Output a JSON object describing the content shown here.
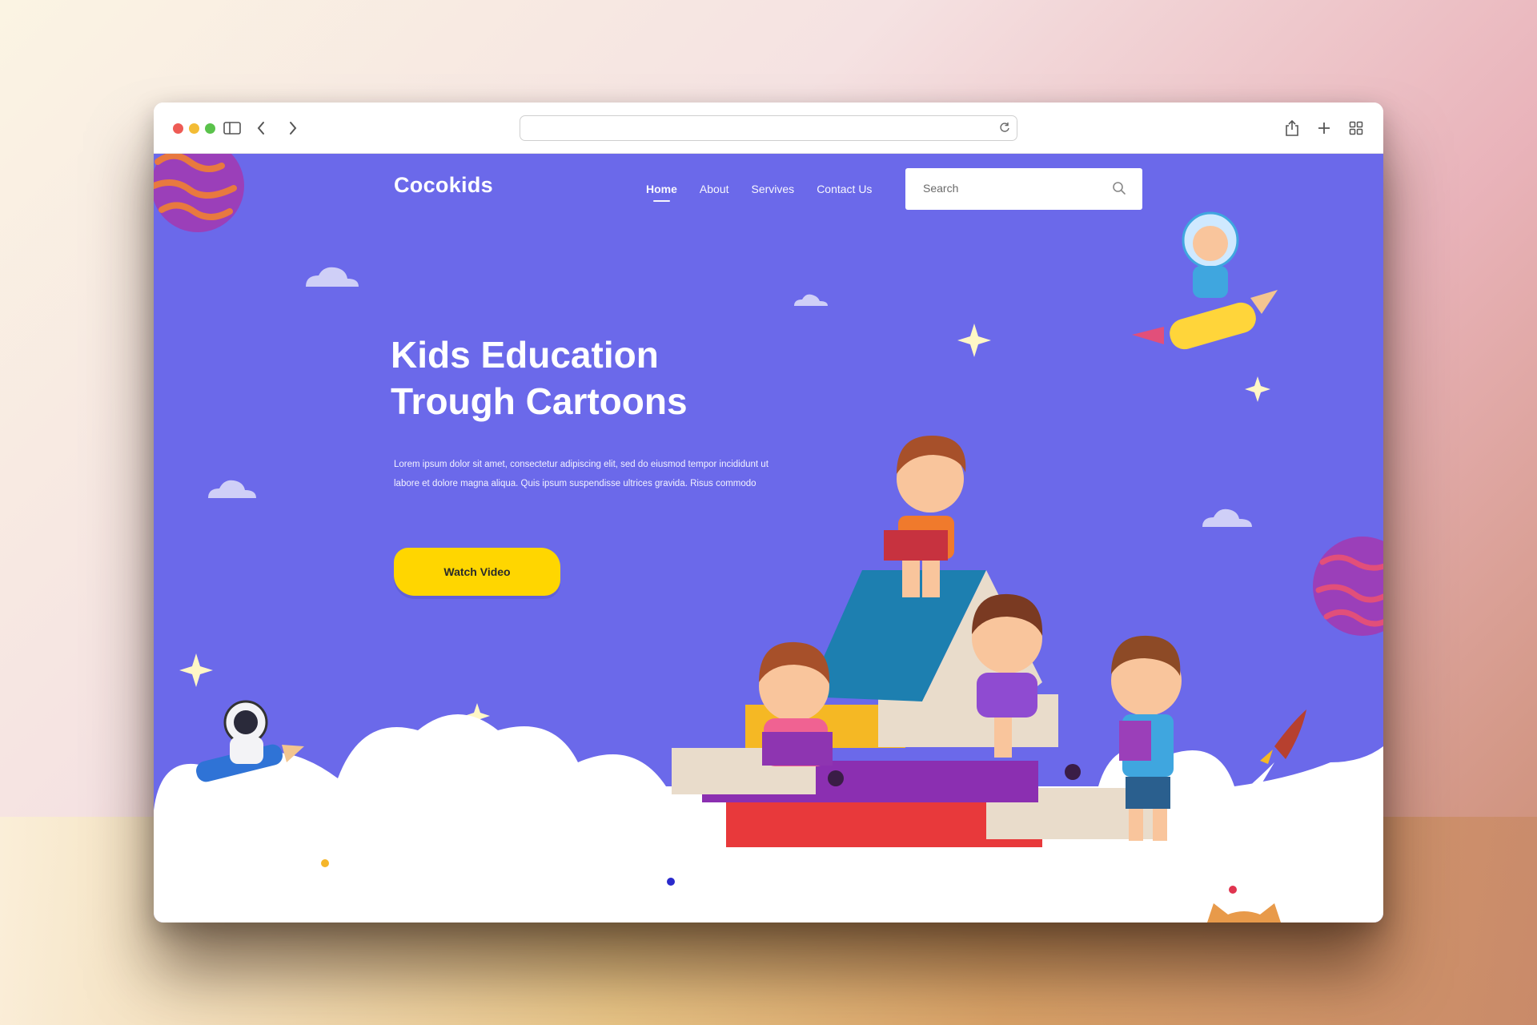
{
  "browser": {
    "address_value": "",
    "icons": [
      "sidebar-icon",
      "back-icon",
      "forward-icon",
      "reload-icon",
      "share-icon",
      "new-tab-icon",
      "tab-overview-icon"
    ]
  },
  "site": {
    "logo": "Cocokids",
    "nav": [
      {
        "label": "Home",
        "active": true
      },
      {
        "label": "About",
        "active": false
      },
      {
        "label": "Servives",
        "active": false
      },
      {
        "label": "Contact Us",
        "active": false
      }
    ],
    "search": {
      "placeholder": "Search",
      "value": ""
    }
  },
  "hero": {
    "title_line1": "Kids Education",
    "title_line2": "Trough Cartoons",
    "text": "Lorem ipsum dolor sit amet, consectetur adipiscing elit, sed do eiusmod tempor incididunt ut labore et dolore magna aliqua. Quis ipsum suspendisse ultrices gravida. Risus commodo",
    "cta_label": "Watch Video"
  },
  "colors": {
    "page_bg": "#6b69ea",
    "cta": "#ffd600",
    "planet": "#8e3fb8",
    "cloud": "#ffffff"
  }
}
